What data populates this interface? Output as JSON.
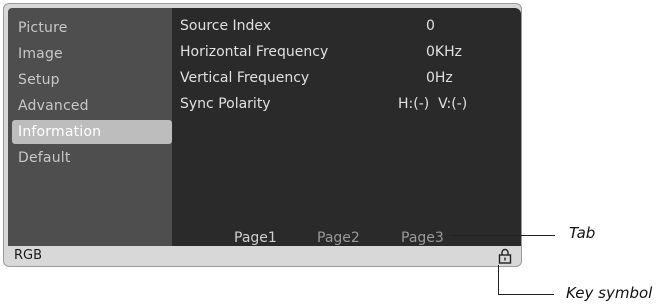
{
  "menu": {
    "items": [
      "Picture",
      "Image",
      "Setup",
      "Advanced",
      "Information",
      "Default"
    ],
    "selected_index": 4
  },
  "info": {
    "rows": [
      {
        "label": "Source Index",
        "value": "0"
      },
      {
        "label": "Horizontal Frequency",
        "value": "0KHz"
      },
      {
        "label": "Vertical Frequency",
        "value": "0Hz"
      },
      {
        "label": "Sync Polarity",
        "value": "H:(-)  V:(-)"
      }
    ]
  },
  "pages": [
    "Page1",
    "Page2",
    "Page3"
  ],
  "active_page_index": 0,
  "status": {
    "text": "RGB",
    "icon": "key-lock-icon"
  },
  "callouts": {
    "tab": "Tab",
    "key": "Key symbol"
  }
}
